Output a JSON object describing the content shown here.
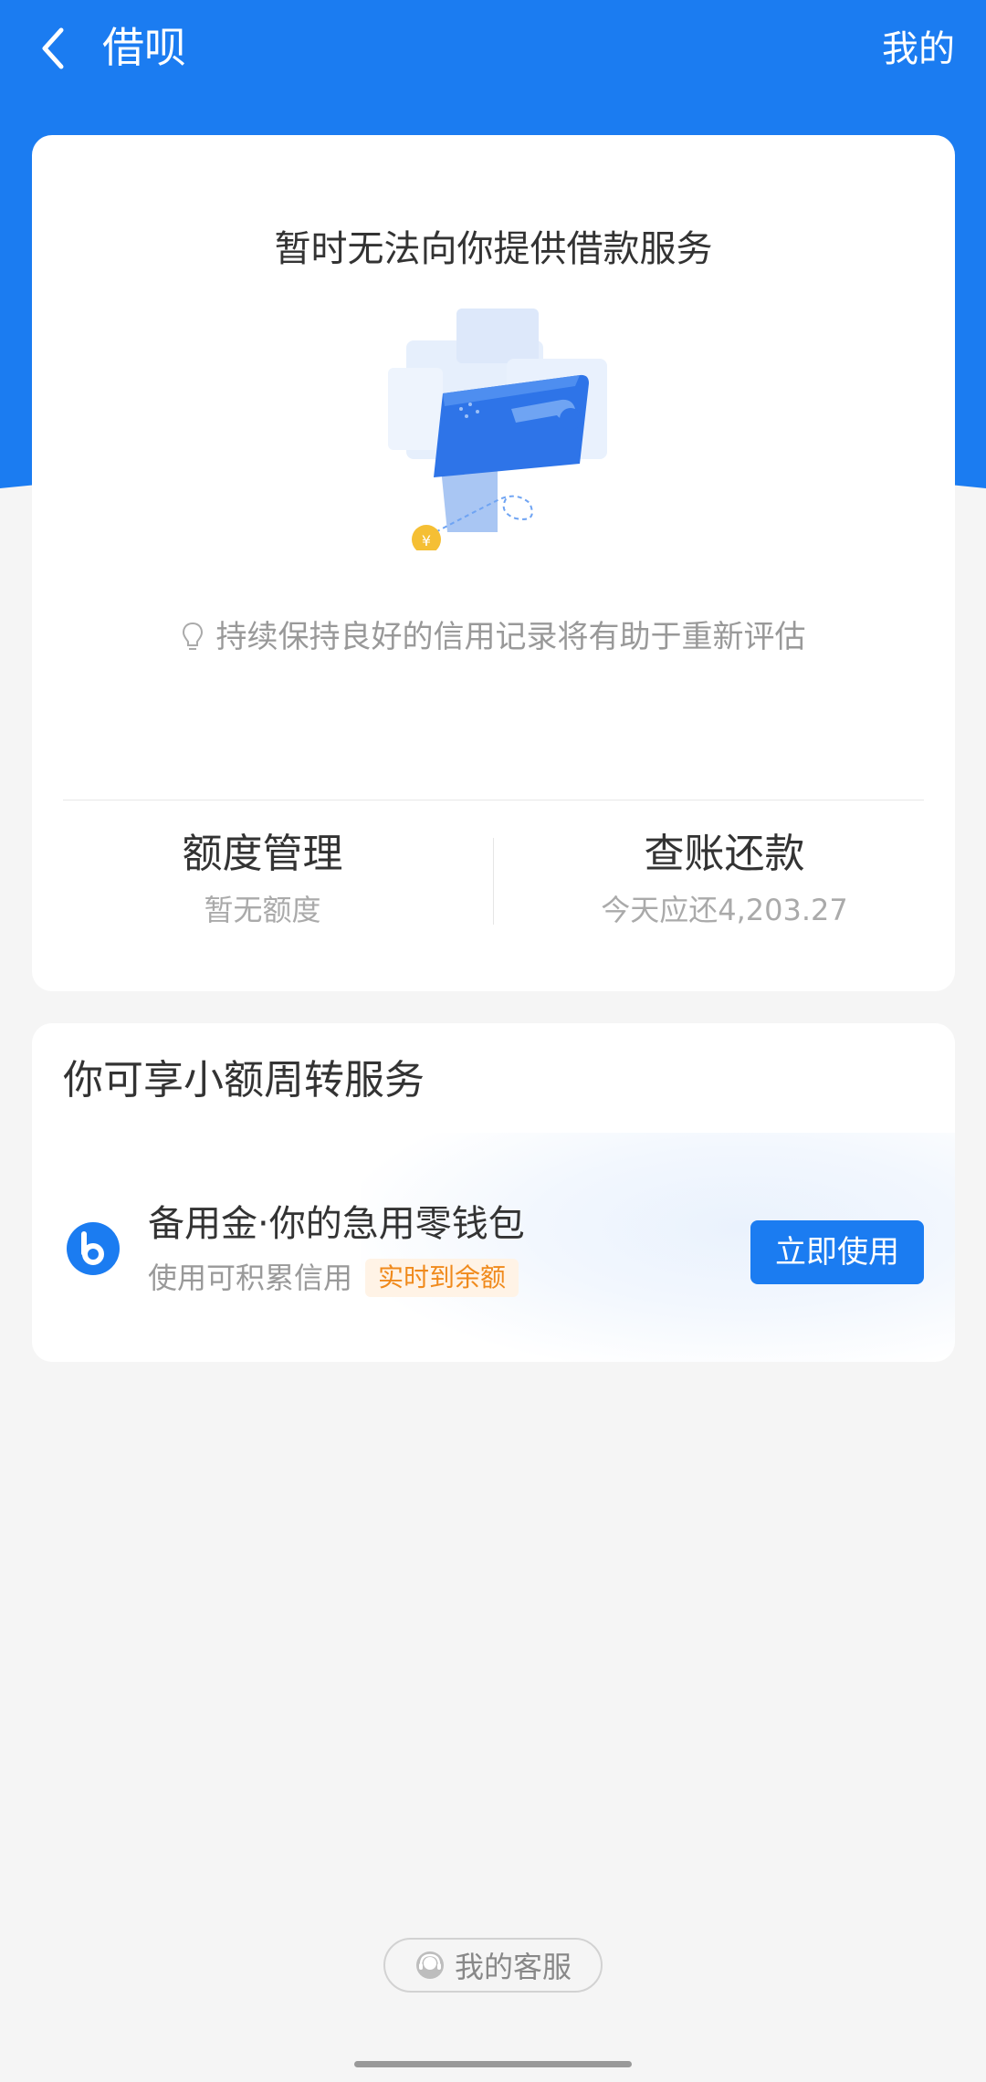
{
  "nav": {
    "title": "借呗",
    "right_label": "我的",
    "back_icon": "chevron-left-icon"
  },
  "main_card": {
    "title": "暂时无法向你提供借款服务",
    "tip_icon": "lightbulb-icon",
    "tip": "持续保持良好的信用记录将有助于重新评估",
    "illustration": "wallet-illustration",
    "limit": {
      "title": "额度管理",
      "subtitle": "暂无额度"
    },
    "bill": {
      "title": "查账还款",
      "subtitle": "今天应还4,203.27"
    }
  },
  "service_card": {
    "title": "你可享小额周转服务",
    "item": {
      "icon": "b-logo-icon",
      "name": "备用金·你的急用零钱包",
      "desc": "使用可积累信用",
      "tag": "实时到余额",
      "button": "立即使用"
    }
  },
  "customer_service": {
    "icon": "headset-icon",
    "label": "我的客服"
  },
  "colors": {
    "brand": "#1b7cf1",
    "tag_bg": "#fff3e6",
    "tag_text": "#f08a1c",
    "page_bg": "#f5f5f5"
  }
}
